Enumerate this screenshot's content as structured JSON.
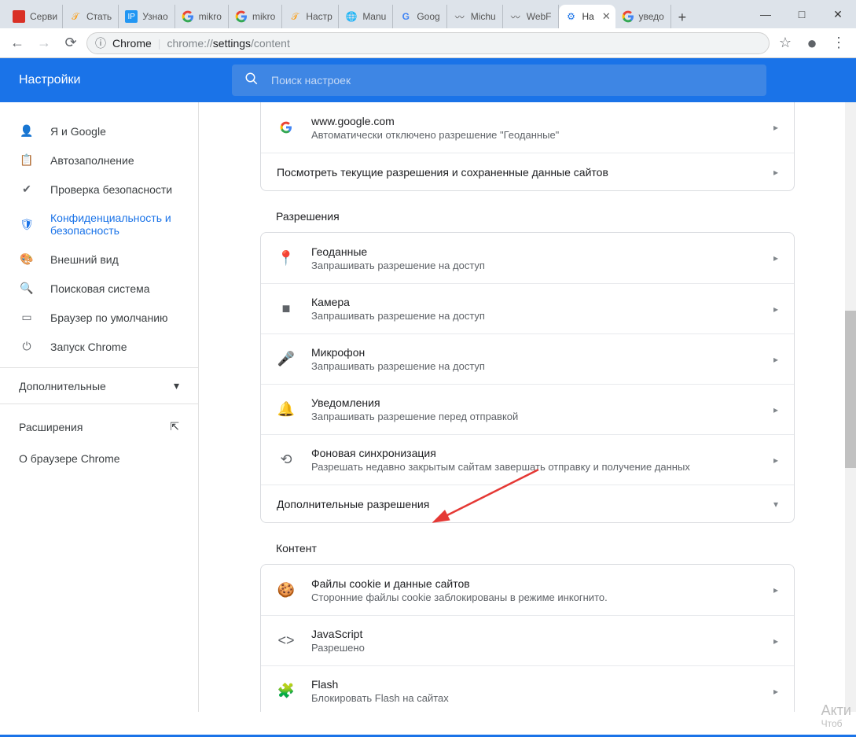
{
  "window": {
    "minimize": "—",
    "maximize": "□",
    "close": "✕"
  },
  "tabs": [
    {
      "label": "Серви",
      "color": "#d93025"
    },
    {
      "label": "Стать",
      "color": "#888"
    },
    {
      "label": "Узнао",
      "color": "#2196f3"
    },
    {
      "label": "mikro",
      "color": "#4285f4"
    },
    {
      "label": "mikro",
      "color": "#4285f4"
    },
    {
      "label": "Настр",
      "color": "#888"
    },
    {
      "label": "Manu",
      "color": "#666"
    },
    {
      "label": "Goog",
      "color": "#4285f4"
    },
    {
      "label": "Michu",
      "color": "#666"
    },
    {
      "label": "WebF",
      "color": "#666"
    },
    {
      "label": "На",
      "color": "#1a73e8",
      "active": true
    },
    {
      "label": "уведо",
      "color": "#4285f4"
    }
  ],
  "address": {
    "scheme_label": "Chrome",
    "url_prefix": "chrome://",
    "url_mid": "settings",
    "url_suffix": "/content"
  },
  "header": {
    "title": "Настройки",
    "search_placeholder": "Поиск настроек"
  },
  "sidebar": {
    "items": [
      {
        "icon": "person",
        "label": "Я и Google"
      },
      {
        "icon": "autofill",
        "label": "Автозаполнение"
      },
      {
        "icon": "security",
        "label": "Проверка безопасности"
      },
      {
        "icon": "privacy",
        "label": "Конфиденциальность и безопасность",
        "active": true
      },
      {
        "icon": "appearance",
        "label": "Внешний вид"
      },
      {
        "icon": "search",
        "label": "Поисковая система"
      },
      {
        "icon": "browser",
        "label": "Браузер по умолчанию"
      },
      {
        "icon": "startup",
        "label": "Запуск Chrome"
      }
    ],
    "advanced": "Дополнительные",
    "extensions": "Расширения",
    "about": "О браузере Chrome"
  },
  "content": {
    "recent": {
      "site": "www.google.com",
      "sub": "Автоматически отключено разрешение \"Геоданные\""
    },
    "view_permissions": "Посмотреть текущие разрешения и сохраненные данные сайтов",
    "permissions_title": "Разрешения",
    "permissions": [
      {
        "icon": "location",
        "title": "Геоданные",
        "sub": "Запрашивать разрешение на доступ"
      },
      {
        "icon": "camera",
        "title": "Камера",
        "sub": "Запрашивать разрешение на доступ"
      },
      {
        "icon": "mic",
        "title": "Микрофон",
        "sub": "Запрашивать разрешение на доступ"
      },
      {
        "icon": "bell",
        "title": "Уведомления",
        "sub": "Запрашивать разрешение перед отправкой"
      },
      {
        "icon": "sync",
        "title": "Фоновая синхронизация",
        "sub": "Разрешать недавно закрытым сайтам завершать отправку и получение данных"
      }
    ],
    "additional_permissions": "Дополнительные разрешения",
    "content_title": "Контент",
    "content_items": [
      {
        "icon": "cookie",
        "title": "Файлы cookie и данные сайтов",
        "sub": "Сторонние файлы cookie заблокированы в режиме инкогнито."
      },
      {
        "icon": "code",
        "title": "JavaScript",
        "sub": "Разрешено"
      },
      {
        "icon": "flash",
        "title": "Flash",
        "sub": "Блокировать Flash на сайтах"
      }
    ]
  },
  "watermark": {
    "line1": "Акти",
    "line2": "Чтоб"
  }
}
